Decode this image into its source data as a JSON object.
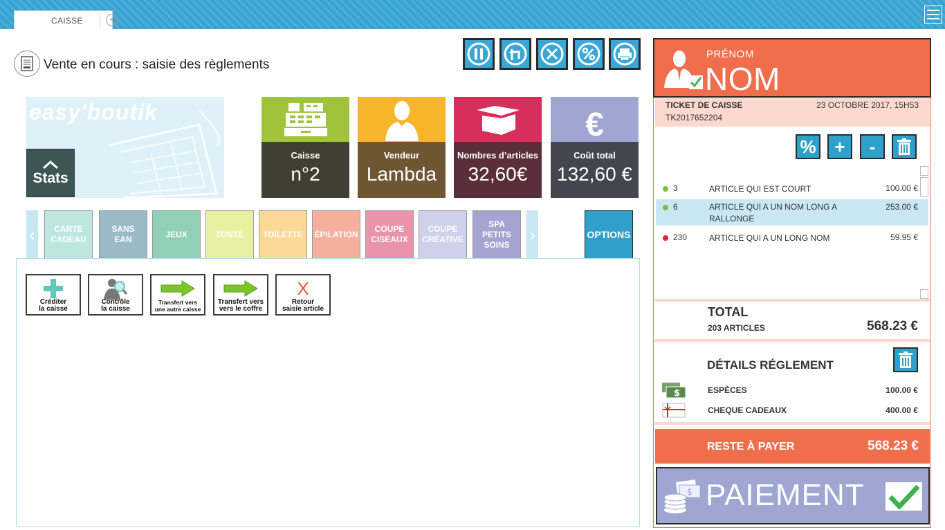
{
  "tabs": [
    {
      "label": "CAISSE"
    }
  ],
  "page": {
    "title": "Vente en cours : saisie des règlements"
  },
  "banner": {
    "logo": "easy'boutik",
    "stats_label": "Stats"
  },
  "tiles": [
    {
      "label": "Caisse",
      "value": "n°2",
      "top_color": "#9fc33a",
      "bottom_color": "#3f3f33"
    },
    {
      "label": "Vendeur",
      "value": "Lambda",
      "top_color": "#f7b52b",
      "bottom_color": "#6e5632"
    },
    {
      "label": "Nombres d’articles",
      "value": "32,60€",
      "top_color": "#d4305b",
      "bottom_color": "#5a2e3b"
    },
    {
      "label": "Coût total",
      "value": "132,60 €",
      "top_color": "#9ea6d1",
      "bottom_color": "#45454f"
    }
  ],
  "categories": [
    {
      "label": "CARTE\nCADEAU",
      "color": "#bde6e1"
    },
    {
      "label": "SANS\nEAN",
      "color": "#9bbac7"
    },
    {
      "label": "JEUX",
      "color": "#8fd0b7"
    },
    {
      "label": "TONTE",
      "color": "#e6f1a1"
    },
    {
      "label": "TOILETTE",
      "color": "#fcd996"
    },
    {
      "label": "ÉPILATION",
      "color": "#f5af9c"
    },
    {
      "label": "COUPE\nCISEAUX",
      "color": "#ea94ab"
    },
    {
      "label": "COUPE\nCRÉATIVE",
      "color": "#cdd1ea"
    },
    {
      "label": "SPA\nPETITS\nSOINS",
      "color": "#a7a3d0"
    }
  ],
  "options_label": "OPTIONS",
  "functions": [
    {
      "line1": "Créditer",
      "line2": "la caisse",
      "icon": "plus-icon"
    },
    {
      "line1": "Contrôle",
      "line2": "la caisse",
      "icon": "inspector-icon"
    },
    {
      "line1": "Transfert vers",
      "line2": "une autre caisse",
      "icon": "arrow-right-icon"
    },
    {
      "line1": "Transfert vers",
      "line2": "vers le coffre",
      "icon": "arrow-right-icon"
    },
    {
      "line1": "Retour",
      "line2": "saisie article",
      "icon": "x-icon"
    }
  ],
  "user": {
    "prenom": "PRÉNOM",
    "nom": "NOM"
  },
  "ticket": {
    "title": "TICKET DE CAISSE",
    "date": "23 OCTOBRE 2017, 15H53",
    "id": "TK2017652204",
    "lines": [
      {
        "qty": "3",
        "name": "ARTICLE QUI EST COURT",
        "price": "100.00 €",
        "status_color": "#7ac143"
      },
      {
        "qty": "6",
        "name": "ARTICLE QUI A UN NOM LONG A RALLONGE",
        "price": "253.00 €",
        "status_color": "#7ac143"
      },
      {
        "qty": "230",
        "name": "ARTICLE QUI A UN LONG NOM",
        "price": "59.95 €",
        "status_color": "#e2262b"
      }
    ],
    "total_label": "TOTAL",
    "total_count": "203 ARTICLES",
    "total_amount": "568.23 €",
    "details_label": "DÉTAILS RÉGLEMENT",
    "payments": [
      {
        "name": "ESPÈCES",
        "amount": "100.00 €",
        "icon": "cash-icon"
      },
      {
        "name": "CHEQUE CADEAUX",
        "amount": "400.00 €",
        "icon": "gift-voucher-icon"
      }
    ],
    "reste_label": "RESTE À PAYER",
    "reste_amount": "568.23 €",
    "paiement_label": "PAIEMENT"
  }
}
